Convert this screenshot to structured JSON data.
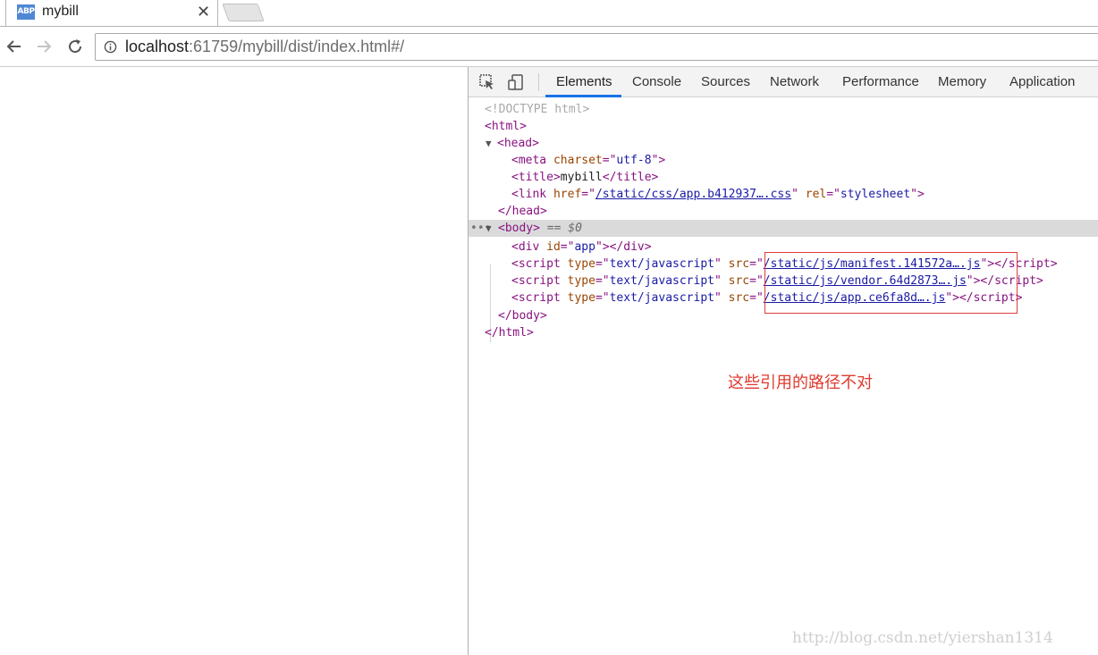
{
  "browser": {
    "tab": {
      "favicon_text": "ABP",
      "title": "mybill"
    },
    "address": {
      "host": "localhost",
      "rest": ":61759/mybill/dist/index.html#/"
    }
  },
  "devtools": {
    "tabs": [
      "Elements",
      "Console",
      "Sources",
      "Network",
      "Performance",
      "Memory",
      "Application"
    ],
    "active_tab": "Elements",
    "dom": {
      "doctype": "<!DOCTYPE html>",
      "title_text": "mybill",
      "meta_charset": "utf-8",
      "link_href": "/static/css/app.b412937….css",
      "link_rel": "stylesheet",
      "body_suffix": "== $0",
      "div_id": "app",
      "script_type": "text/javascript",
      "scripts": [
        "/static/js/manifest.141572a….js",
        "/static/js/vendor.64d2873….js",
        "/static/js/app.ce6fa8d….js"
      ]
    },
    "annotation": "这些引用的路径不对",
    "watermark": "http://blog.csdn.net/yiershan1314"
  },
  "colors": {
    "accent": "#1a73e8",
    "annotation": "#e03c3c"
  }
}
